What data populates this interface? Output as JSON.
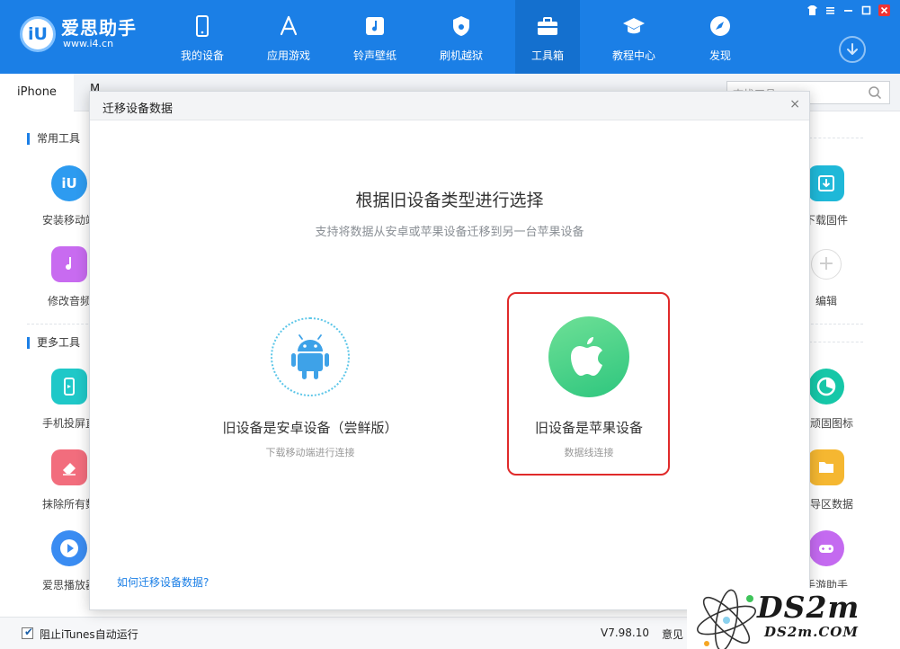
{
  "app": {
    "logo_mark": "iU",
    "logo_name": "爱思助手",
    "logo_url": "www.i4.cn"
  },
  "nav": [
    {
      "label": "我的设备",
      "icon": "phone-icon"
    },
    {
      "label": "应用游戏",
      "icon": "app-store-icon"
    },
    {
      "label": "铃声壁纸",
      "icon": "music-icon"
    },
    {
      "label": "刷机越狱",
      "icon": "shield-icon"
    },
    {
      "label": "工具箱",
      "icon": "toolbox-icon",
      "active": true
    },
    {
      "label": "教程中心",
      "icon": "graduation-cap-icon"
    },
    {
      "label": "发现",
      "icon": "compass-icon"
    }
  ],
  "tabs": {
    "device": "iPhone",
    "second": "M"
  },
  "search": {
    "placeholder": "查找工具"
  },
  "sections": {
    "common": "常用工具",
    "more": "更多工具"
  },
  "tools_left": [
    {
      "name": "安装移动端",
      "icon": "i4-app-icon",
      "color": "#2d9bf0"
    },
    {
      "name": "修改音频",
      "icon": "ringtone-icon",
      "color": "#c86bf0"
    },
    {
      "name": "手机投屏直",
      "icon": "screen-mirror-icon",
      "color": "#1fc8c8"
    },
    {
      "name": "抹除所有数",
      "icon": "eraser-icon",
      "color": "#f26d7d"
    },
    {
      "name": "爱思播放器",
      "icon": "play-icon",
      "color": "#3a8cf2"
    }
  ],
  "tools_right": [
    {
      "name": "下载固件",
      "icon": "firmware-download-icon",
      "color": "#1fb8d8"
    },
    {
      "name": "编辑",
      "icon": "plus-icon",
      "color": "#cccccc"
    },
    {
      "name": "除顽固图标",
      "icon": "pie-icon",
      "color": "#16c7a8"
    },
    {
      "name": "引导区数据",
      "icon": "folder-icon",
      "color": "#f5b731"
    },
    {
      "name": "手游助手",
      "icon": "gamepad-icon",
      "color": "#c46af0"
    }
  ],
  "footer": {
    "itunes_label": "阻止iTunes自动运行",
    "itunes_checked": true,
    "version": "V7.98.10",
    "feedback": "意见"
  },
  "modal": {
    "title": "迁移设备数据",
    "close": "×",
    "heading": "根据旧设备类型进行选择",
    "subheading": "支持将数据从安卓或苹果设备迁移到另一台苹果设备",
    "android": {
      "title": "旧设备是安卓设备（尝鲜版）",
      "subtitle": "下载移动端进行连接"
    },
    "apple": {
      "title": "旧设备是苹果设备",
      "subtitle": "数据线连接"
    },
    "help_link": "如何迁移设备数据?"
  },
  "watermark": {
    "big": "DS2m",
    "small": "DS2m.COM"
  },
  "colors": {
    "brand": "#1b7fe6",
    "highlight": "#e02a2a",
    "apple_green": "#2ec67e",
    "android_blue": "#5cc6e8"
  }
}
